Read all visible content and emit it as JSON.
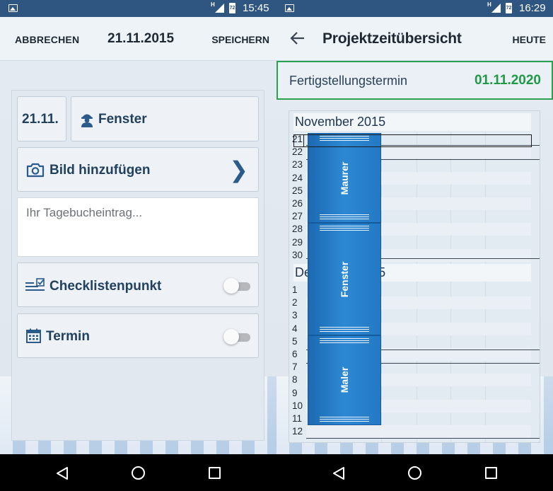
{
  "left": {
    "statusbar": {
      "network": "H",
      "battery": "72",
      "time": "15:45"
    },
    "appbar": {
      "cancel": "ABBRECHEN",
      "date": "21.11.2015",
      "save": "SPEICHERN"
    },
    "entry": {
      "date": "21.11.",
      "trade": "Fenster",
      "trade_icon": "worker-icon",
      "add_photo": "Bild hinzufügen",
      "diary_placeholder": "Ihr Tagebucheintrag...",
      "checklist": "Checklistenpunkt",
      "checklist_enabled": false,
      "appointment": "Termin",
      "appointment_enabled": false
    }
  },
  "right": {
    "statusbar": {
      "network": "H",
      "battery": "72",
      "time": "16:29"
    },
    "appbar": {
      "title": "Projektzeitübersicht",
      "today": "HEUTE"
    },
    "deadline": {
      "label": "Fertigstellungstermin",
      "date": "01.11.2020",
      "color": "#1f9947"
    },
    "calendar": {
      "months": [
        {
          "name": "November 2015",
          "days": [
            "21",
            "22",
            "23",
            "24",
            "25",
            "26",
            "27",
            "28",
            "29",
            "30"
          ]
        },
        {
          "name": "Dezember 2015",
          "days": [
            "1",
            "2",
            "3",
            "4",
            "5",
            "6",
            "7",
            "8",
            "9",
            "10",
            "11",
            "12"
          ]
        }
      ],
      "selected_day": "21",
      "tasks": [
        {
          "label": "Maurer",
          "start": "21.11.2015",
          "end": "27.11.2015"
        },
        {
          "label": "Fenster",
          "start": "28.11.2015",
          "end": "4.12.2015"
        },
        {
          "label": "Maler",
          "start": "5.12.2015",
          "end": "11.12.2015"
        }
      ],
      "bar_color": "#2379c4"
    }
  },
  "colors": {
    "statusbar": "#2f5680",
    "accent_text": "#21415e"
  }
}
